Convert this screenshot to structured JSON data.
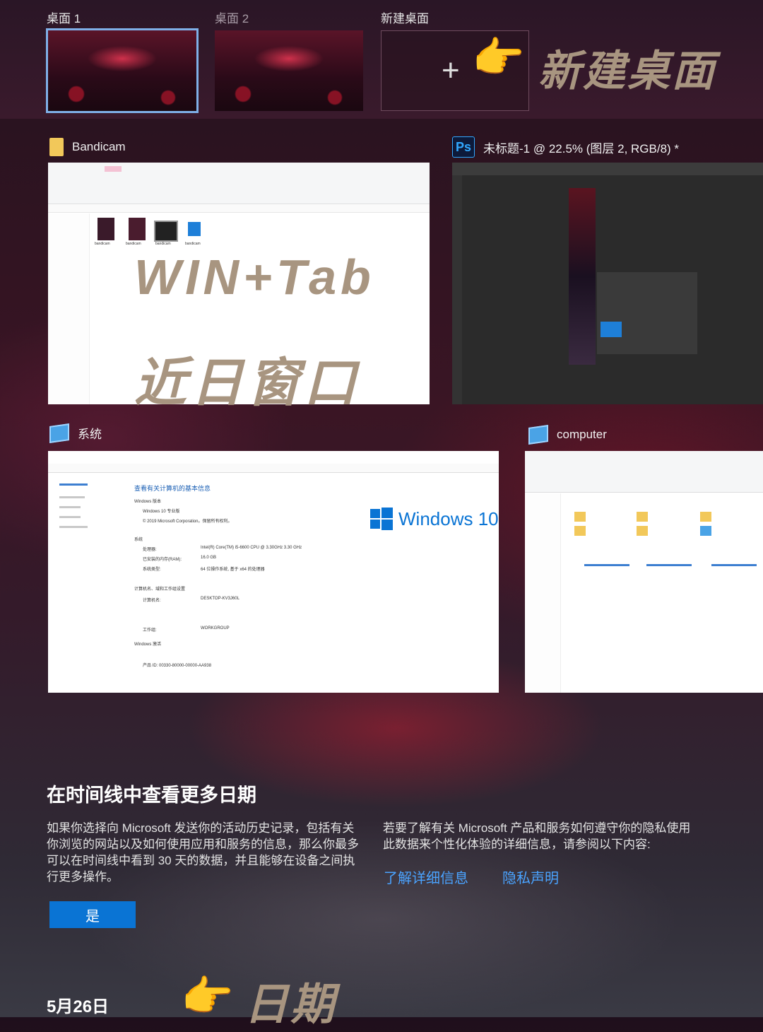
{
  "desktops": {
    "items": [
      {
        "label": "桌面 1"
      },
      {
        "label": "桌面 2"
      },
      {
        "label": "新建桌面"
      }
    ],
    "add_symbol": "+",
    "callout": "新建桌面"
  },
  "windows": {
    "bandicam": {
      "title": "Bandicam",
      "file_labels": [
        "bandicam",
        "bandicam",
        "bandicam",
        "bandicam"
      ]
    },
    "photoshop": {
      "icon_text": "Ps",
      "title": "未标题-1 @ 22.5% (图层 2, RGB/8) *"
    },
    "system": {
      "title": "系统",
      "heading": "查看有关计算机的基本信息",
      "windows_logo_text": "Windows 10",
      "sections": [
        "Windows 版本",
        "系统",
        "计算机名、域和工作组设置",
        "Windows 激活"
      ],
      "rows": [
        {
          "label": "处理器:",
          "value": "Intel(R) Core(TM) i5-6600 CPU @ 3.30GHz   3.30 GHz"
        },
        {
          "label": "已安装的内存(RAM):",
          "value": "16.0 GB"
        },
        {
          "label": "系统类型:",
          "value": "64 位操作系统, 基于 x64 的处理器"
        },
        {
          "label": "计算机名:",
          "value": "DESKTOP-KV3J60L"
        },
        {
          "label": "工作组:",
          "value": "WORKGROUP"
        }
      ],
      "copyright": "© 2019 Microsoft Corporation。保留所有权利。",
      "edition": "Windows 10 专业版",
      "product_id": "产品 ID: 00330-80000-00000-AA938"
    },
    "computer": {
      "title": "computer"
    }
  },
  "overlays": {
    "shortcut": "WIN+Tab",
    "recent": "近日窗口",
    "date_callout": "日期"
  },
  "timeline": {
    "title": "在时间线中查看更多日期",
    "body_left": "如果你选择向 Microsoft 发送你的活动历史记录，包括有关你浏览的网站以及如何使用应用和服务的信息，那么你最多可以在时间线中看到 30 天的数据，并且能够在设备之间执行更多操作。",
    "body_right": "若要了解有关 Microsoft 产品和服务如何遵守你的隐私使用此数据来个性化体验的详细信息，请参阅以下内容:",
    "link_details": "了解详细信息",
    "link_privacy": "隐私声明",
    "yes_label": "是",
    "date": "5月26日"
  },
  "colors": {
    "accent_blue": "#0a74d4",
    "link_blue": "#4aa3ff",
    "callout_tan": "#a89580",
    "active_desktop_border": "#7fb0e8"
  },
  "icons": {
    "hand": "pointing-hand-icon",
    "folder": "folder-icon",
    "photoshop": "photoshop-icon",
    "computer": "computer-icon",
    "plus": "plus-icon"
  }
}
